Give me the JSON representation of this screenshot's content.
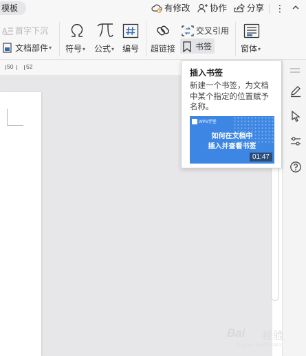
{
  "topbar": {
    "template_tab": "模板",
    "has_changes": "有修改",
    "collaborate": "协作",
    "share": "分享",
    "more": "⋮"
  },
  "ribbon": {
    "first_line_indent": "首字下沉",
    "doc_parts": "文档部件",
    "symbol": "符号",
    "formula": "公式",
    "numbering": "编号",
    "hyperlink": "超链接",
    "cross_reference": "交叉引用",
    "bookmark": "书签",
    "window": "窗体"
  },
  "ruler": {
    "mark_50": "50",
    "mark_52": "52"
  },
  "tooltip": {
    "title": "插入书签",
    "description": "新建一个书签，为文档中某个指定的位置赋予名称。",
    "video_logo": "WPS学堂",
    "video_title_line1": "如何在文档中",
    "video_title_line2": "插入并查看书签",
    "duration": "01:47"
  },
  "watermark": {
    "brand": "Bai",
    "sub": "经验",
    "url": "jingyan.baidu.com"
  },
  "colors": {
    "accent_blue": "#3d86e3",
    "icon_blue": "#2d6bb8",
    "background": "#f7f7f8"
  },
  "icons": [
    "cloud-sync-icon",
    "add-user-icon",
    "share-icon",
    "chevron-down-icon",
    "drop-cap-icon",
    "doc-parts-icon",
    "omega-icon",
    "pi-icon",
    "hash-box-icon",
    "link-icon",
    "cross-ref-icon",
    "bookmark-icon",
    "form-window-icon",
    "hamburger-icon",
    "pen-icon",
    "pointer-icon",
    "sliders-icon",
    "help-circle-icon"
  ]
}
